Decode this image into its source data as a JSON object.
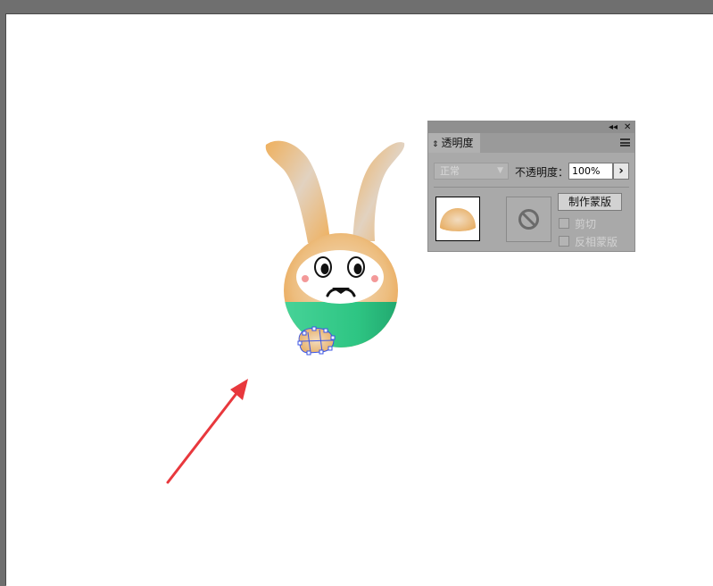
{
  "panel": {
    "tab_label": "透明度",
    "collapse_glyph": "◂◂",
    "close_glyph": "✕",
    "blend_mode": "正常",
    "opacity_label": "不透明度：",
    "opacity_value": "100%",
    "opacity_arrow": "›",
    "make_mask_label": "制作蒙版",
    "clip_label": "剪切",
    "invert_mask_label": "反相蒙版"
  },
  "icons": {
    "tab_arrows": "updown-arrows-icon",
    "menu": "hamburger-menu-icon",
    "no_mask": "prohibited-icon",
    "pointer": "red-arrow-icon"
  },
  "colors": {
    "canvas_bg": "#6f6f6f",
    "artboard": "#ffffff",
    "panel_bg": "#a9a9a9",
    "rabbit_orange": "#efb05d",
    "rabbit_green": "#2ec583",
    "arrow_red": "#e8383d",
    "selection_blue": "#3b55e6"
  }
}
